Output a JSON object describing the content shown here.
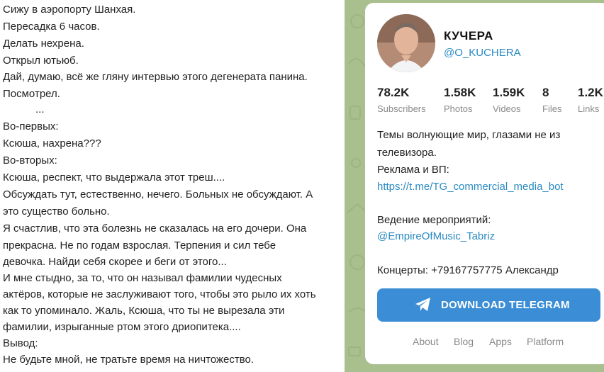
{
  "post": {
    "lines": [
      "Сижу в аэропорту Шанхая.",
      "Пересадка 6 часов.",
      "Делать нехрена.",
      "Открыл ютьюб.",
      "Дай, думаю, всё же гляну интервью этого дегенерата панина.",
      "Посмотрел.",
      "...",
      "Во-первых:",
      "Ксюша, нахрена???",
      "Во-вторых:",
      "Ксюша, респект, что выдержала этот треш....",
      "Обсуждать тут, естественно, нечего. Больных не обсуждают. А",
      "это существо больно.",
      "Я счастлив, что эта болезнь не сказалась на его дочери. Она",
      "прекрасна. Не по годам взрослая. Терпения и сил тебе",
      "девочка. Найди себя скорее и беги от этого...",
      "И мне стыдно, за то, что он называл фамилии чудесных",
      "актёров, которые не заслуживают того, чтобы это рыло их хоть",
      "как то упоминало. Жаль, Ксюша, что ты не вырезала эти",
      "фамилии, изрыганные ртом этого дриопитека....",
      "Вывод:",
      "Не будьте мной, не тратьте время на ничтожество."
    ]
  },
  "channel": {
    "title": "КУЧЕРА",
    "handle": "@O_KUCHERA",
    "stats": [
      {
        "value": "78.2K",
        "label": "Subscribers"
      },
      {
        "value": "1.58K",
        "label": "Photos"
      },
      {
        "value": "1.59K",
        "label": "Videos"
      },
      {
        "value": "8",
        "label": "Files"
      },
      {
        "value": "1.2K",
        "label": "Links"
      }
    ],
    "description": [
      "Темы волнующие мир, глазами не из",
      "телевизора.",
      "Реклама и ВП:",
      "https://t.me/TG_commercial_media_bot",
      "Ведение мероприятий:",
      "@EmpireOfMusic_Tabriz",
      "Концерты: +79167757775 Александр"
    ]
  },
  "download_button": {
    "label": "DOWNLOAD TELEGRAM",
    "icon": "telegram-plane-icon"
  },
  "footer_links": [
    "About",
    "Blog",
    "Apps",
    "Platform"
  ],
  "colors": {
    "link": "#2a8ac2",
    "button": "#3b8ed5",
    "background_pattern": "#a9c08e",
    "muted_text": "#8a8a8a"
  }
}
